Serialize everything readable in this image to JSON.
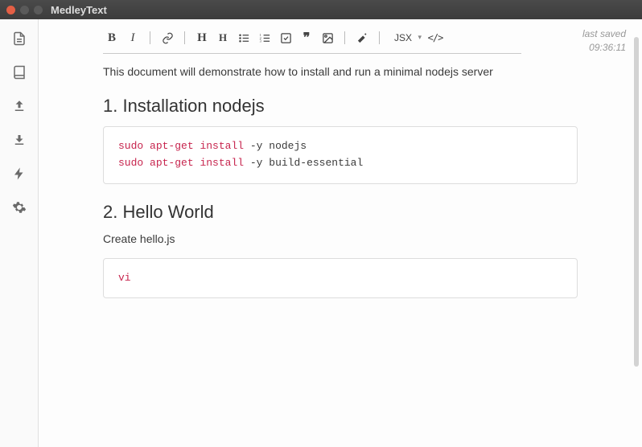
{
  "window": {
    "title": "MedleyText"
  },
  "sidebar": {
    "items": [
      "document-icon",
      "book-icon",
      "upload-icon",
      "download-icon",
      "bolt-icon",
      "gear-icon"
    ]
  },
  "toolbar": {
    "bold": "B",
    "italic": "I",
    "h_big": "H",
    "h_small": "H",
    "lang": "JSX",
    "code_tag": "</>"
  },
  "status": {
    "label": "last saved",
    "time": "09:36:11"
  },
  "doc": {
    "intro": "This document will demonstrate how to install and run a minimal nodejs server",
    "h1": "1. Installation nodejs",
    "code1_kw1": "sudo",
    "code1_kw2": "apt-get",
    "code1_kw3": "install",
    "code1_rest1": " -y nodejs",
    "code1_kw4": "sudo",
    "code1_kw5": "apt-get",
    "code1_kw6": "install",
    "code1_rest2": " -y build-essential",
    "h2": "2. Hello World",
    "p2": "Create hello.js",
    "code2_kw": "vi"
  }
}
